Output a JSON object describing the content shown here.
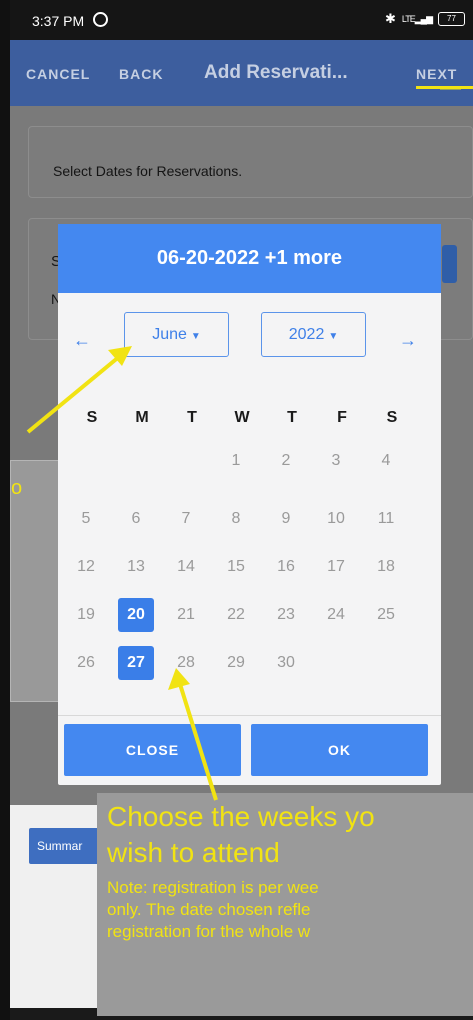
{
  "status_bar": {
    "time": "3:37 PM",
    "whatsapp_icon": "whatsapp-icon",
    "bluetooth_icon": "bluetooth-icon",
    "signal_label": "LTE",
    "battery_level": "77"
  },
  "app_bar": {
    "cancel_label": "CANCEL",
    "back_label": "BACK",
    "title": "Add Reservati...",
    "next_label": "NEXT",
    "background_color": "#3d5e9e"
  },
  "cards": {
    "select_dates_text": "Select Dates for Reservations.",
    "second_card_partial_s": "S",
    "second_card_partial_n": "N"
  },
  "left_panel": {
    "partial_text": "o"
  },
  "date_picker": {
    "header_text": "06-20-2022 +1 more",
    "prev_arrow": "←",
    "next_arrow": "→",
    "month_label": "June",
    "year_label": "2022",
    "weekdays": [
      "S",
      "M",
      "T",
      "W",
      "T",
      "F",
      "S"
    ],
    "weeks": [
      [
        "",
        "",
        "",
        "1",
        "2",
        "3",
        "4"
      ],
      [
        "5",
        "6",
        "7",
        "8",
        "9",
        "10",
        "11"
      ],
      [
        "12",
        "13",
        "14",
        "15",
        "16",
        "17",
        "18"
      ],
      [
        "19",
        "20",
        "21",
        "22",
        "23",
        "24",
        "25"
      ],
      [
        "26",
        "27",
        "28",
        "29",
        "30",
        "",
        ""
      ]
    ],
    "selected_days": [
      "20",
      "27"
    ],
    "close_label": "CLOSE",
    "ok_label": "OK",
    "accent_color": "#4488f0"
  },
  "footer": {
    "summary_label": "Summar"
  },
  "annotation": {
    "headline_line1": "Choose the weeks yo",
    "headline_line2": "wish to attend",
    "note_line1": "Note: registration is per wee",
    "note_line2": "only. The date chosen refle",
    "note_line3": "registration for the whole w",
    "text_color": "#f1e313"
  }
}
